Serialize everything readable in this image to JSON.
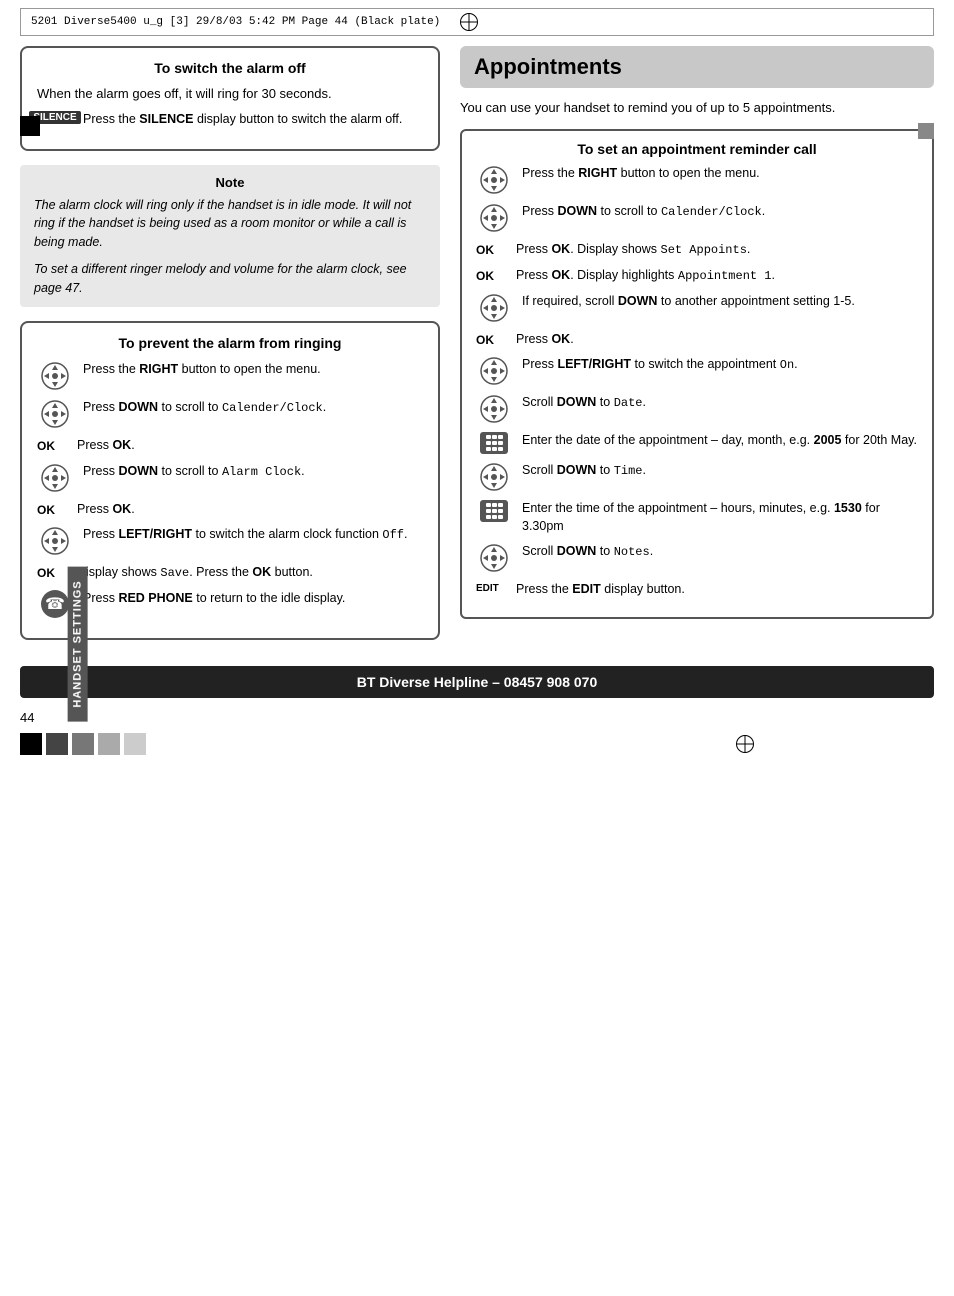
{
  "header": {
    "text": "5201 Diverse5400  u_g [3]  29/8/03  5:42 PM  Page 44   (Black plate)"
  },
  "sidebar": {
    "label": "HANDSET SETTINGS"
  },
  "left_column": {
    "switch_alarm": {
      "title": "To switch the alarm off",
      "body_text": "When the alarm goes off, it will ring for 30 seconds.",
      "silence_step": {
        "label": "SILENCE",
        "text": "Press the SILENCE display button to switch the alarm off."
      }
    },
    "note": {
      "title": "Note",
      "lines": [
        "The alarm clock will ring only if the handset is in idle mode. It will not ring if the handset is being used as a room monitor or while a call is being made.",
        "To set a different ringer melody and volume for the alarm clock, see page 47."
      ]
    },
    "prevent_alarm": {
      "title": "To prevent the alarm from ringing",
      "steps": [
        {
          "icon": "nav",
          "label": "",
          "text": "Press the RIGHT button to open the menu."
        },
        {
          "icon": "nav",
          "label": "",
          "text": "Press DOWN to scroll to Calender/Clock."
        },
        {
          "icon": "",
          "label": "OK",
          "text": "Press OK."
        },
        {
          "icon": "nav",
          "label": "",
          "text": "Press DOWN to scroll to Alarm Clock."
        },
        {
          "icon": "",
          "label": "OK",
          "text": "Press OK."
        },
        {
          "icon": "nav",
          "label": "",
          "text": "Press LEFT/RIGHT to switch the alarm clock function Off."
        },
        {
          "icon": "",
          "label": "OK",
          "text": "Display shows Save. Press the OK button."
        },
        {
          "icon": "phone",
          "label": "",
          "text": "Press RED PHONE to return to the idle display."
        }
      ]
    }
  },
  "right_column": {
    "heading": "Appointments",
    "intro": "You can use your handset to remind you of up to 5 appointments.",
    "set_appointment": {
      "title": "To set an appointment reminder call",
      "steps": [
        {
          "icon": "nav",
          "label": "",
          "text": "Press the RIGHT button to open the menu."
        },
        {
          "icon": "nav",
          "label": "",
          "text": "Press DOWN to scroll to Calender/Clock."
        },
        {
          "icon": "",
          "label": "OK",
          "text": "Press OK.  Display shows Set Appoints."
        },
        {
          "icon": "",
          "label": "OK",
          "text": "Press OK. Display highlights Appointment 1."
        },
        {
          "icon": "nav",
          "label": "",
          "text": "If required, scroll DOWN to another appointment setting 1-5."
        },
        {
          "icon": "",
          "label": "OK",
          "text": "Press OK."
        },
        {
          "icon": "nav",
          "label": "",
          "text": "Press LEFT/RIGHT to switch the appointment On."
        },
        {
          "icon": "nav",
          "label": "",
          "text": "Scroll DOWN to Date."
        },
        {
          "icon": "kbd",
          "label": "",
          "text": "Enter the date of the appointment – day, month, e.g. 2005 for 20th May."
        },
        {
          "icon": "nav",
          "label": "",
          "text": "Scroll DOWN to Time."
        },
        {
          "icon": "kbd",
          "label": "",
          "text": "Enter the time of the appointment – hours, minutes, e.g. 1530 for 3.30pm"
        },
        {
          "icon": "nav",
          "label": "",
          "text": "Scroll DOWN to Notes."
        },
        {
          "icon": "",
          "label": "EDIT",
          "text": "Press the EDIT display button."
        }
      ]
    }
  },
  "footer": {
    "text": "BT Diverse Helpline – 08457 908 070"
  },
  "page_number": "44"
}
